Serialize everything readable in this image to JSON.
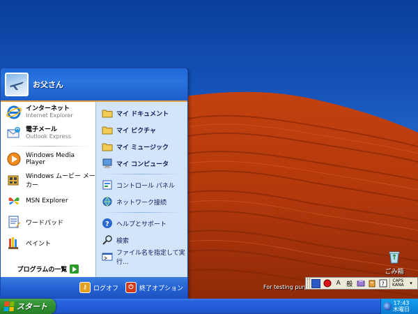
{
  "desktop": {
    "overlay_text": "For testing purp",
    "recycle_bin_label": "ごみ箱"
  },
  "start_menu": {
    "user_name": "お父さん",
    "pinned": [
      {
        "title": "インターネット",
        "subtitle": "Internet Explorer",
        "icon": "internet-explorer-icon"
      },
      {
        "title": "電子メール",
        "subtitle": "Outlook Express",
        "icon": "outlook-express-icon"
      }
    ],
    "frequent": [
      {
        "label": "Windows Media Player",
        "icon": "media-player-icon"
      },
      {
        "label": "Windows ムービー メーカー",
        "icon": "movie-maker-icon"
      },
      {
        "label": "MSN Explorer",
        "icon": "msn-butterfly-icon"
      },
      {
        "label": "ワードパッド",
        "icon": "wordpad-icon"
      },
      {
        "label": "ペイント",
        "icon": "paint-icon"
      }
    ],
    "all_programs_label": "プログラムの一覧",
    "places": [
      {
        "label": "マイ ドキュメント",
        "icon": "folder-icon",
        "bold": true
      },
      {
        "label": "マイ ピクチャ",
        "icon": "folder-icon",
        "bold": true
      },
      {
        "label": "マイ ミュージック",
        "icon": "folder-icon",
        "bold": true
      },
      {
        "label": "マイ コンピュータ",
        "icon": "computer-icon",
        "bold": true
      }
    ],
    "system": [
      {
        "label": "コントロール パネル",
        "icon": "control-panel-icon"
      },
      {
        "label": "ネットワーク接続",
        "icon": "network-icon"
      }
    ],
    "support": [
      {
        "label": "ヘルプとサポート",
        "icon": "help-icon"
      },
      {
        "label": "検索",
        "icon": "search-icon"
      },
      {
        "label": "ファイル名を指定して実行...",
        "icon": "run-icon"
      }
    ],
    "logoff_label": "ログオフ",
    "shutdown_label": "終了オプション"
  },
  "taskbar": {
    "start_label": "スタート",
    "clock_time": "17:43",
    "clock_day": "木曜日"
  },
  "language_bar": {
    "mode": "A",
    "kanji_mode": "般",
    "caps": "CAPS",
    "kana": "KANA"
  },
  "colors": {
    "taskbar_blue": "#245edb",
    "start_green": "#2f8f2f",
    "menu_right_panel": "#d3e5fa",
    "header_separator": "#e39c3c"
  }
}
